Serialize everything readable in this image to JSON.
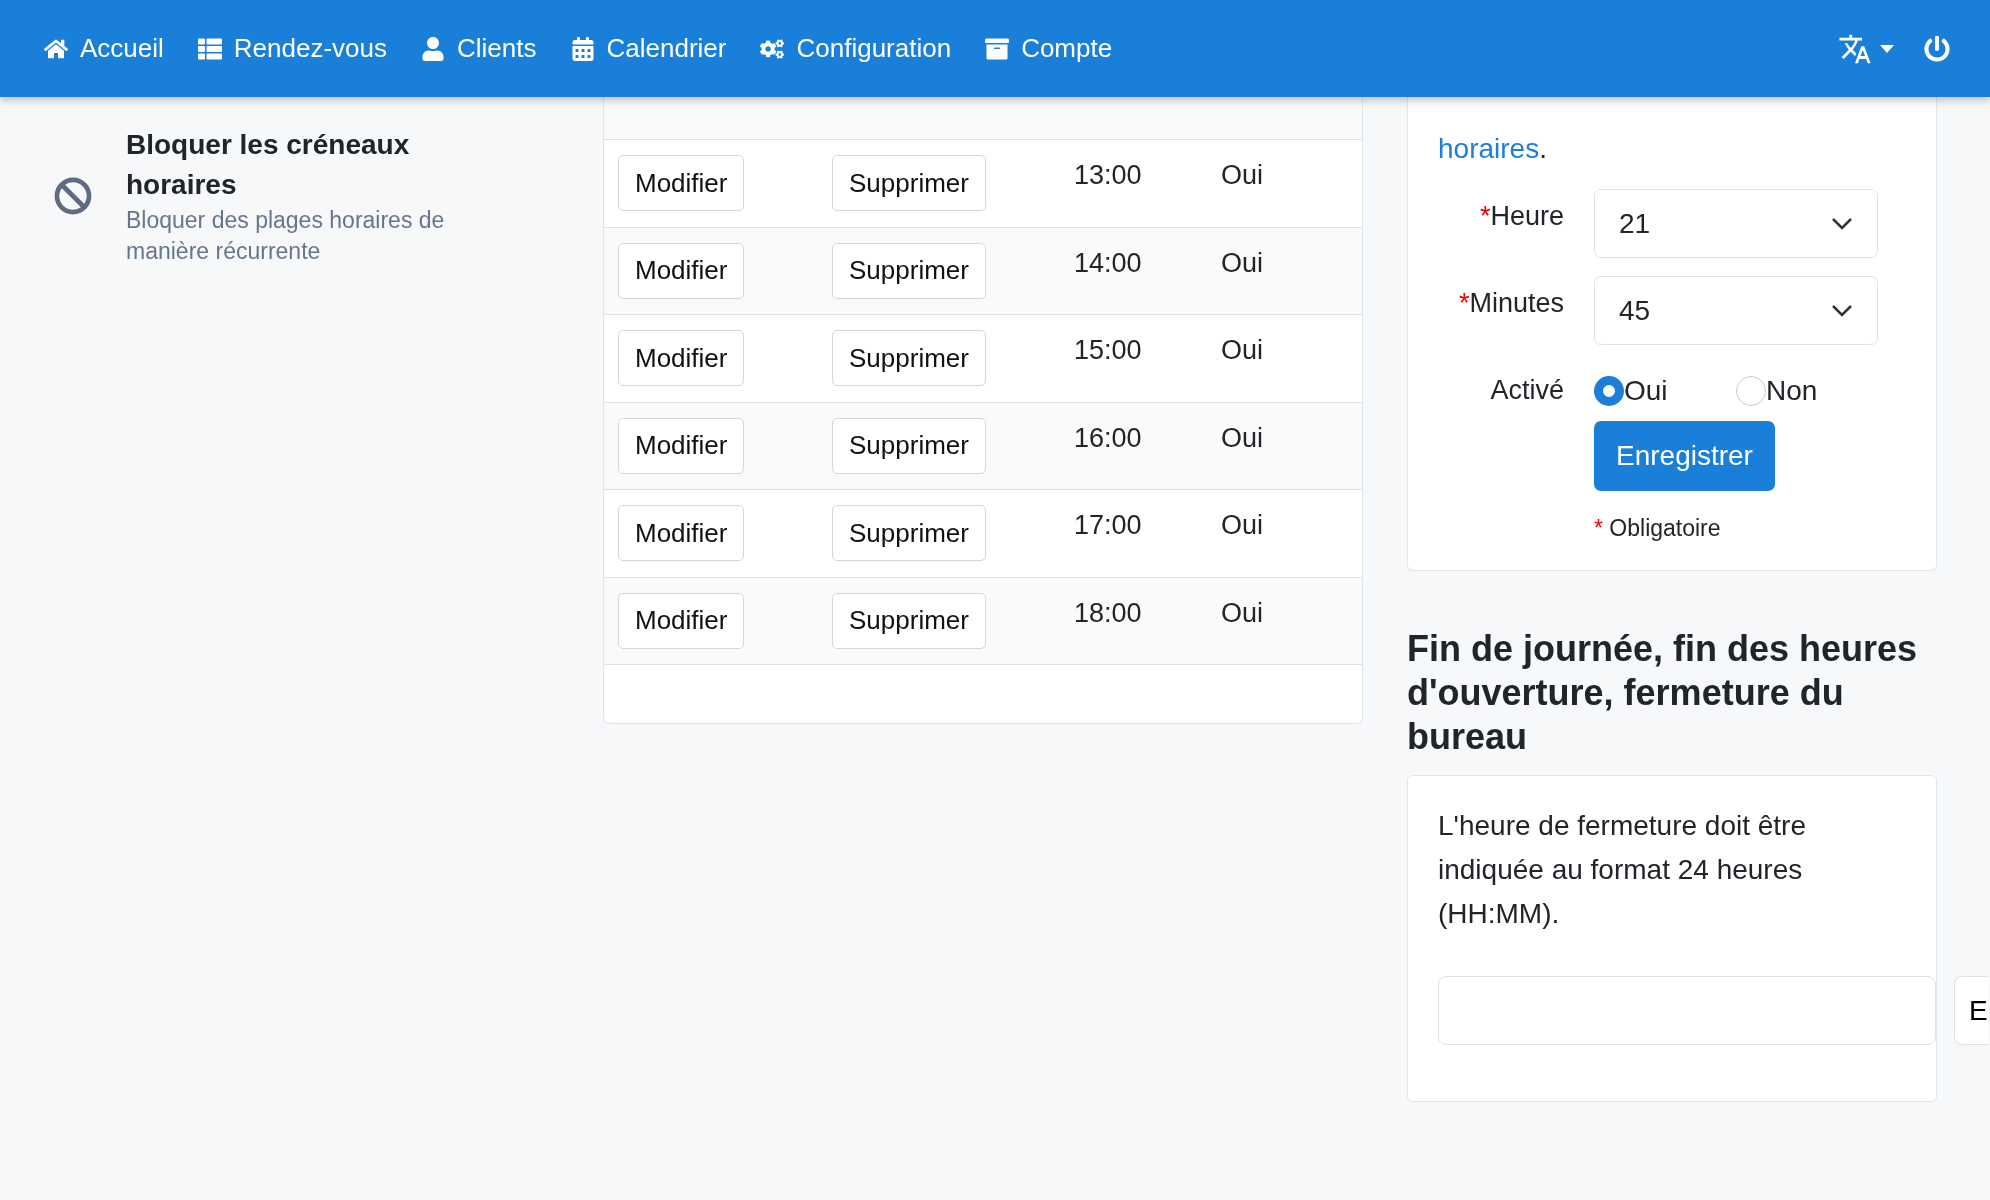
{
  "navbar": {
    "items": [
      {
        "label": "Accueil"
      },
      {
        "label": "Rendez-vous"
      },
      {
        "label": "Clients"
      },
      {
        "label": "Calendrier"
      },
      {
        "label": "Configuration"
      },
      {
        "label": "Compte"
      }
    ]
  },
  "sidebar": {
    "title": "Bloquer les créneaux horaires",
    "subtitle": "Bloquer des plages horaires de manière récurrente"
  },
  "table": {
    "rows": [
      {
        "edit": "Modifier",
        "delete": "Supprimer",
        "time": "13:00",
        "active": "Oui"
      },
      {
        "edit": "Modifier",
        "delete": "Supprimer",
        "time": "14:00",
        "active": "Oui"
      },
      {
        "edit": "Modifier",
        "delete": "Supprimer",
        "time": "15:00",
        "active": "Oui"
      },
      {
        "edit": "Modifier",
        "delete": "Supprimer",
        "time": "16:00",
        "active": "Oui"
      },
      {
        "edit": "Modifier",
        "delete": "Supprimer",
        "time": "17:00",
        "active": "Oui"
      },
      {
        "edit": "Modifier",
        "delete": "Supprimer",
        "time": "18:00",
        "active": "Oui"
      }
    ]
  },
  "form_card": {
    "link": "horaires",
    "intro_end": ".",
    "fields": [
      {
        "required_mark": "*",
        "label": "Heure",
        "value": "21"
      },
      {
        "required_mark": "*",
        "label": "Minutes",
        "value": "45"
      }
    ],
    "active": {
      "label": "Activé",
      "options": [
        {
          "label": "Oui",
          "selected": true
        },
        {
          "label": "Non",
          "selected": false
        }
      ]
    },
    "save_button": "Enregistrer",
    "required_mark": "*",
    "required_note": "Obligatoire"
  },
  "closing_section": {
    "heading": "Fin de journée, fin des heures d'ouverture, fermeture du bureau",
    "text": "L'heure de fermeture doit être indiquée au format 24 heures (HH:MM).",
    "button": "E"
  }
}
